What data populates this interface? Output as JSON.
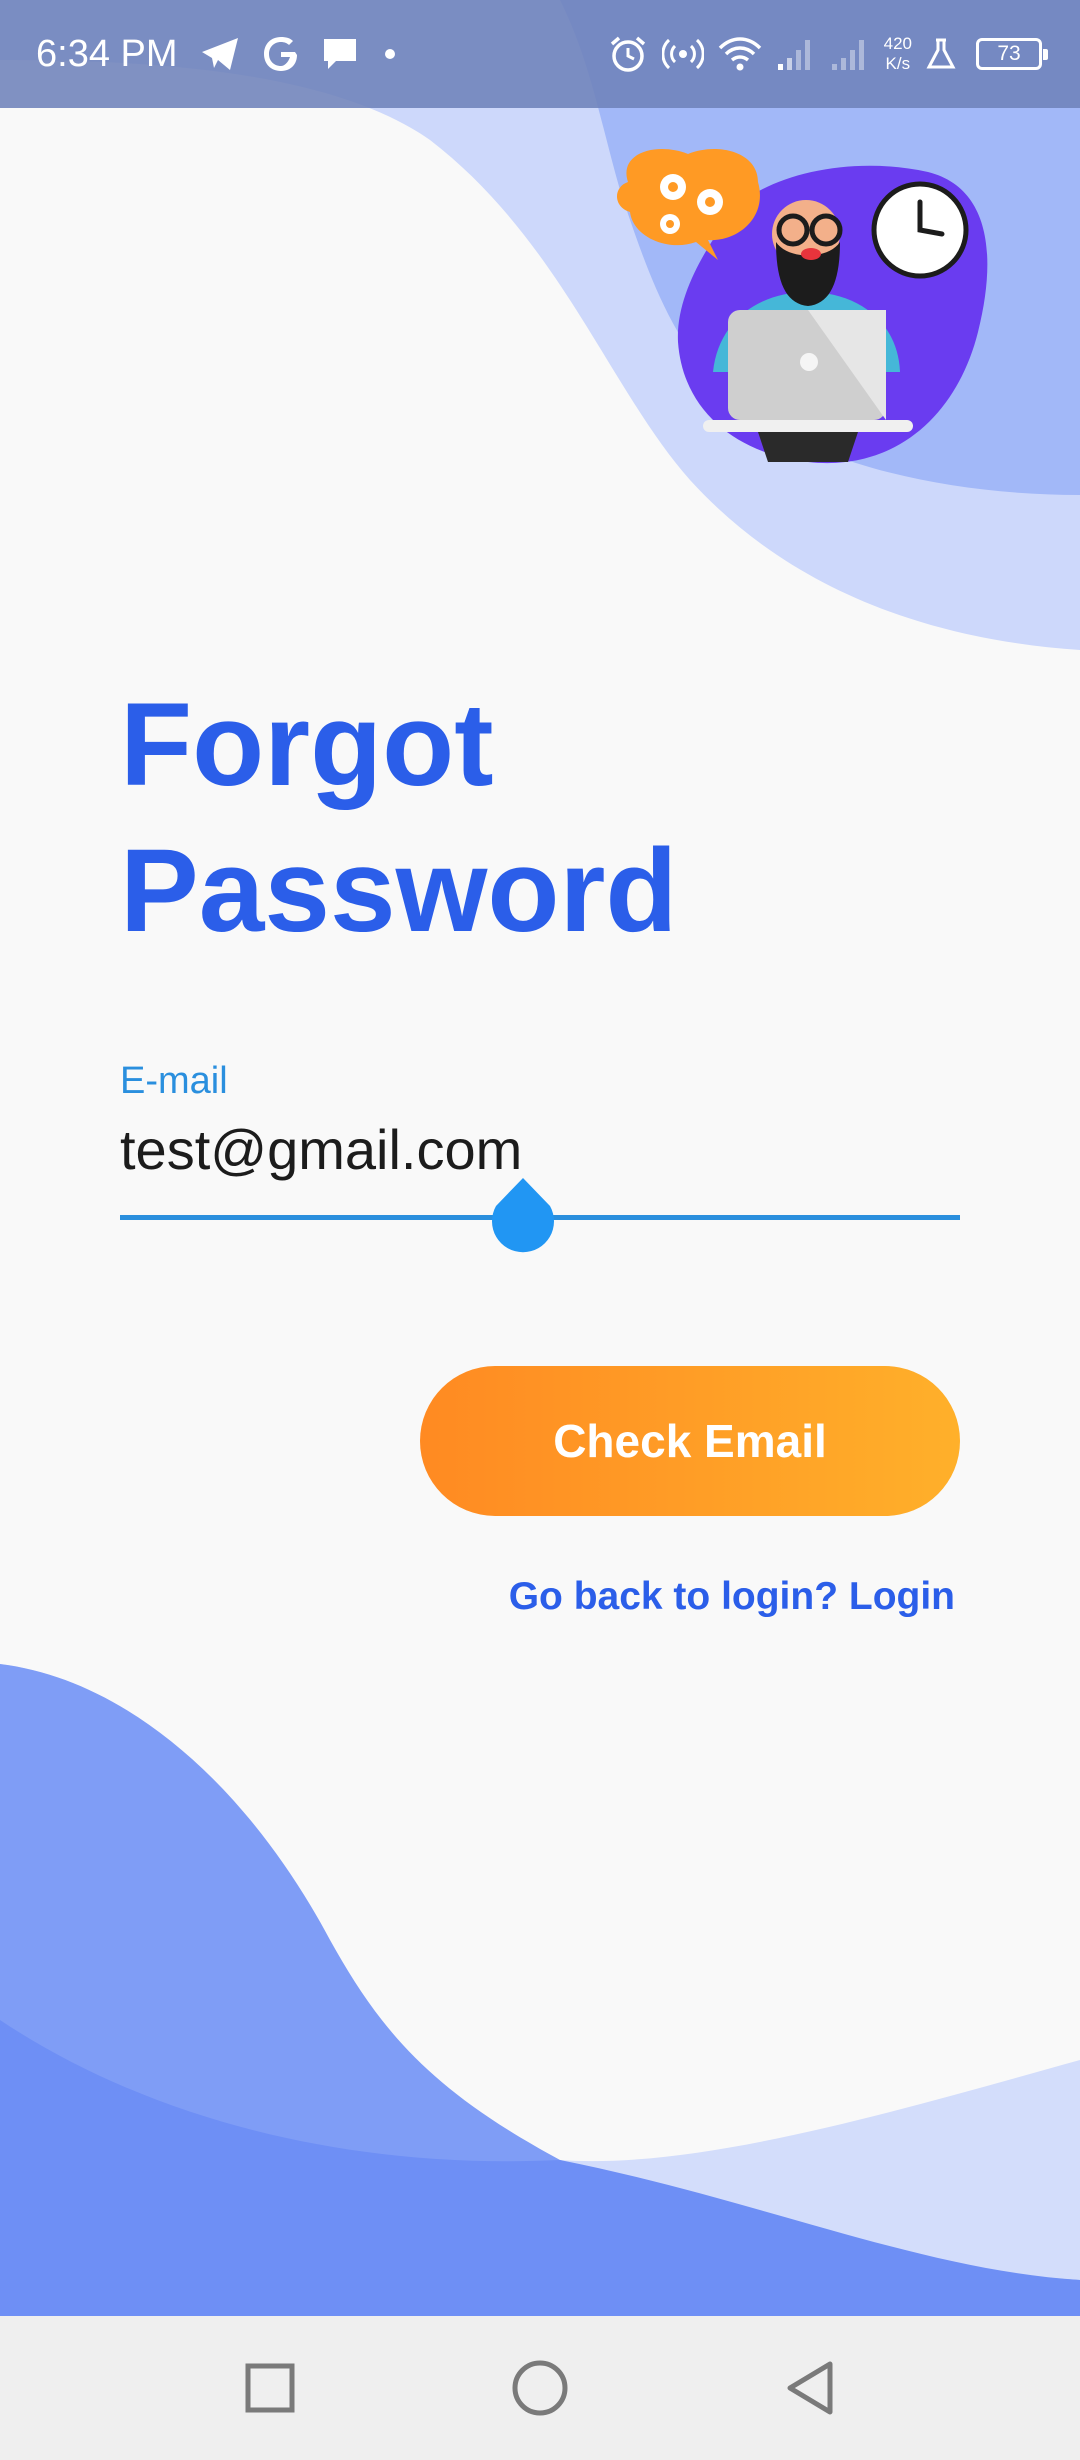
{
  "status_bar": {
    "time": "6:34 PM",
    "net_speed_value": "420",
    "net_speed_unit": "K/s",
    "battery": "73",
    "icons": [
      "telegram-icon",
      "google-icon",
      "message-icon",
      "dot-icon",
      "alarm-icon",
      "hotspot-icon",
      "wifi-icon",
      "signal-icon",
      "signal-icon",
      "lab-icon",
      "battery-icon"
    ]
  },
  "header": {
    "title_line1": "Forgot",
    "title_line2": "Password"
  },
  "form": {
    "email_label": "E-mail",
    "email_value": "test@gmail.com",
    "submit_label": "Check Email",
    "back_link": "Go back to login? Login"
  },
  "nav": {
    "icons": [
      "recents-icon",
      "home-icon",
      "back-icon"
    ]
  },
  "colors": {
    "primary": "#2b5ee9",
    "accent_blue": "#2a8fde",
    "button_start": "#ff8a22",
    "button_end": "#ffb02a"
  }
}
